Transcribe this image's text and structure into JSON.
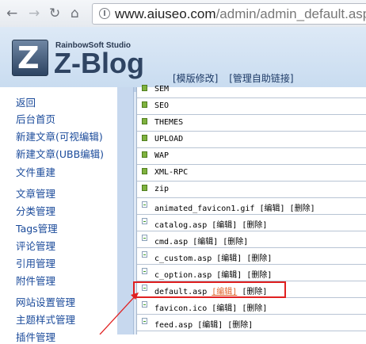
{
  "browser": {
    "back_icon": "back-arrow-icon",
    "forward_icon": "forward-arrow-icon",
    "reload_icon": "reload-icon",
    "home_icon": "home-icon",
    "url_domain": "www.aiuseo.com",
    "url_path": "/admin/admin_default.asp"
  },
  "header": {
    "logo_letter": "Z",
    "studio": "RainbowSoft Studio",
    "brand": "Z-Blog",
    "links": [
      "[模版修改]",
      "[管理自助链接]"
    ]
  },
  "sidebar": {
    "items": [
      "返回",
      "后台首页",
      "新建文章(可视编辑)",
      "新建文章(UBB编辑)",
      "文件重建",
      "文章管理",
      "分类管理",
      "Tags管理",
      "评论管理",
      "引用管理",
      "附件管理",
      "网站设置管理",
      "主题样式管理",
      "插件管理"
    ]
  },
  "files": {
    "edit_label": "[编辑]",
    "delete_label": "[删除]",
    "rows": [
      {
        "name": "SEM",
        "type": "folder"
      },
      {
        "name": "SEO",
        "type": "folder"
      },
      {
        "name": "THEMES",
        "type": "folder"
      },
      {
        "name": "UPLOAD",
        "type": "folder"
      },
      {
        "name": "WAP",
        "type": "folder"
      },
      {
        "name": "XML-RPC",
        "type": "folder"
      },
      {
        "name": "zip",
        "type": "folder"
      },
      {
        "name": "animated_favicon1.gif",
        "type": "file"
      },
      {
        "name": "catalog.asp",
        "type": "file"
      },
      {
        "name": "cmd.asp",
        "type": "file"
      },
      {
        "name": "c_custom.asp",
        "type": "file"
      },
      {
        "name": "c_option.asp",
        "type": "file"
      },
      {
        "name": "default.asp",
        "type": "file"
      },
      {
        "name": "favicon.ico",
        "type": "file"
      },
      {
        "name": "feed.asp",
        "type": "file"
      }
    ]
  },
  "colors": {
    "highlight_border": "#e02020",
    "edit_link_highlight": "#e0622a",
    "sidebar_link": "#1a4a9a"
  }
}
